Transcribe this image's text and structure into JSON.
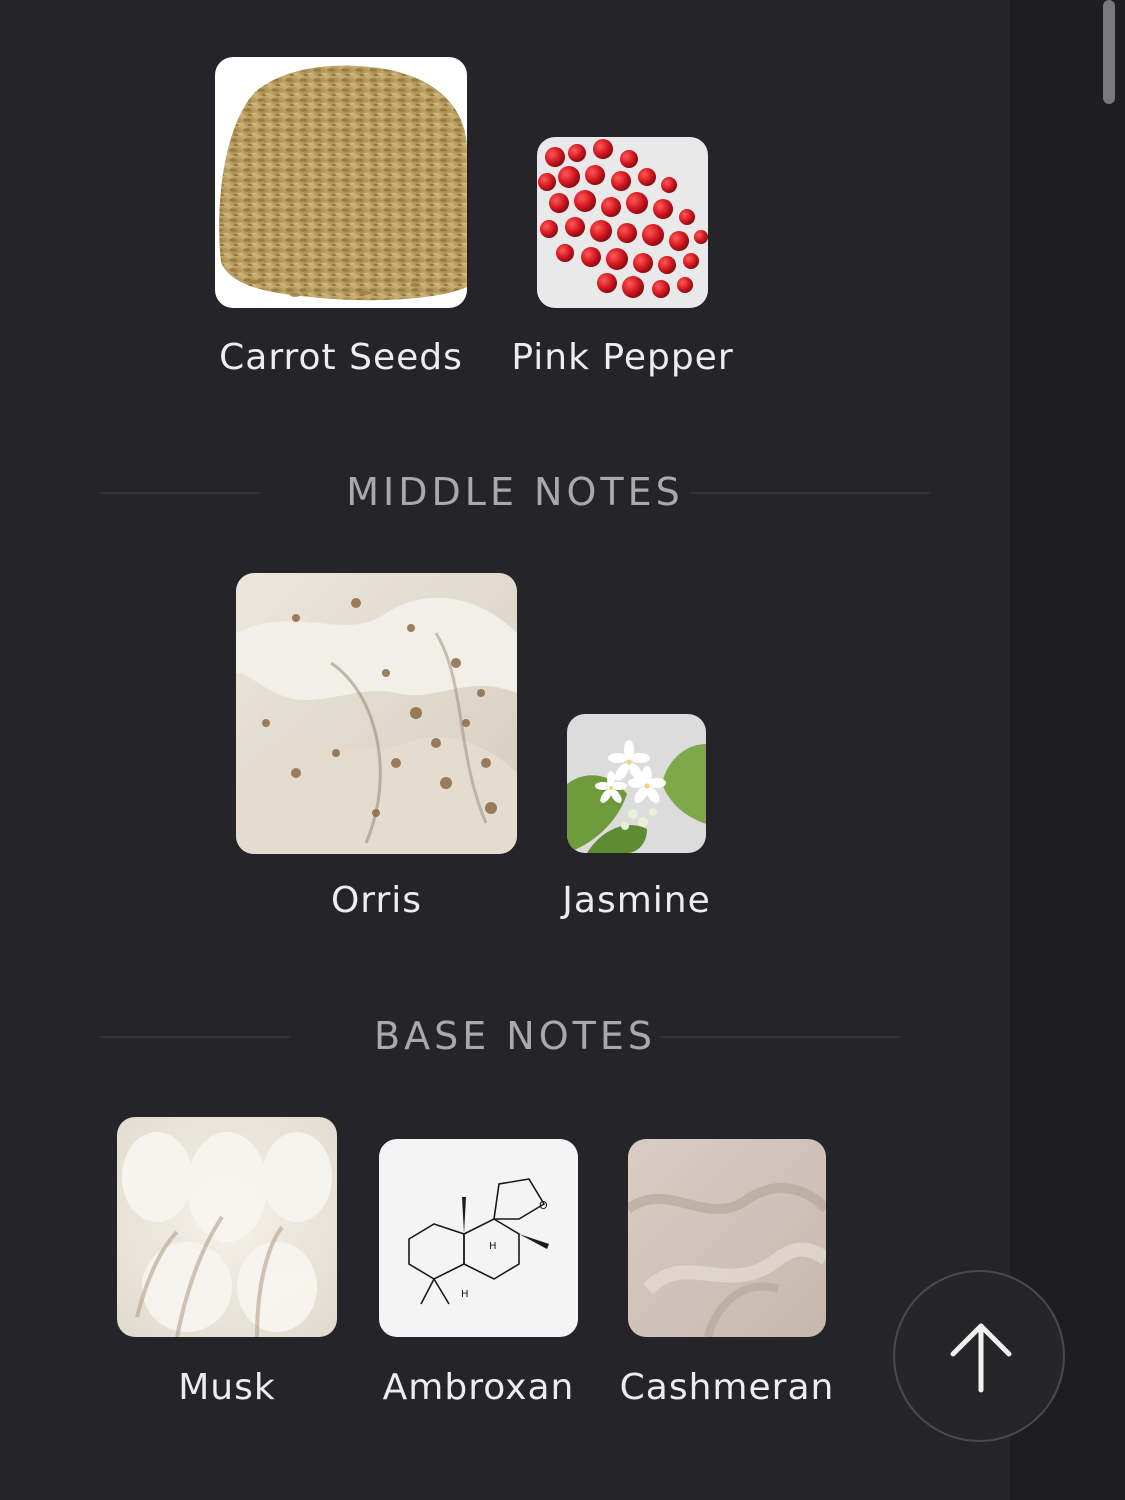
{
  "top_notes": {
    "items": [
      {
        "name": "Carrot Seeds",
        "icon": "carrot-seeds-image"
      },
      {
        "name": "Pink Pepper",
        "icon": "pink-pepper-image"
      }
    ]
  },
  "middle_notes": {
    "title": "MIDDLE NOTES",
    "items": [
      {
        "name": "Orris",
        "icon": "orris-image"
      },
      {
        "name": "Jasmine",
        "icon": "jasmine-image"
      }
    ]
  },
  "base_notes": {
    "title": "BASE NOTES",
    "items": [
      {
        "name": "Musk",
        "icon": "musk-image"
      },
      {
        "name": "Ambroxan",
        "icon": "ambroxan-image"
      },
      {
        "name": "Cashmeran",
        "icon": "cashmeran-image"
      }
    ]
  },
  "scroll_to_top": {
    "icon": "arrow-up-icon"
  },
  "colors": {
    "background": "#252529",
    "gutter": "#1e1e21",
    "label_text": "#ecedef",
    "section_title": "#a8a9ae"
  }
}
